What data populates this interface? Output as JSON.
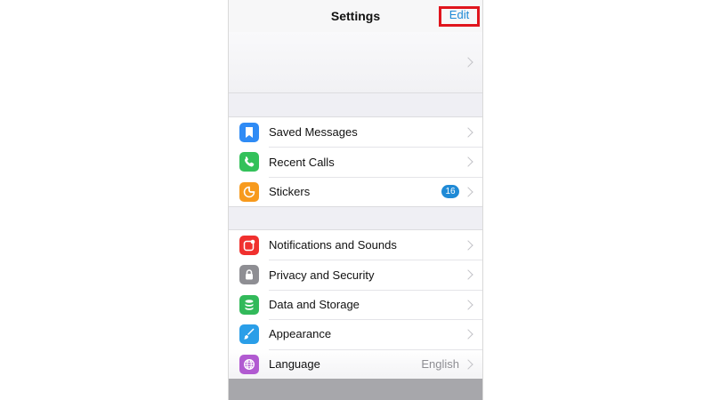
{
  "nav": {
    "title": "Settings",
    "edit_label": "Edit"
  },
  "colors": {
    "accent": "#1f8ad6",
    "highlight_box": "#e0151d"
  },
  "group1": [
    {
      "label": "Saved Messages",
      "icon": "bookmark-icon",
      "icon_color": "#2f8bf5"
    },
    {
      "label": "Recent Calls",
      "icon": "phone-icon",
      "icon_color": "#33c15a"
    },
    {
      "label": "Stickers",
      "icon": "sticker-icon",
      "icon_color": "#f79a1d",
      "badge": "16"
    }
  ],
  "group2": [
    {
      "label": "Notifications and Sounds",
      "icon": "notification-icon",
      "icon_color": "#f0302e"
    },
    {
      "label": "Privacy and Security",
      "icon": "lock-icon",
      "icon_color": "#8e8e93"
    },
    {
      "label": "Data and Storage",
      "icon": "database-icon",
      "icon_color": "#32b95a"
    },
    {
      "label": "Appearance",
      "icon": "brush-icon",
      "icon_color": "#2a9ee8"
    },
    {
      "label": "Language",
      "icon": "globe-icon",
      "icon_color": "#b15ad1",
      "value": "English"
    }
  ]
}
